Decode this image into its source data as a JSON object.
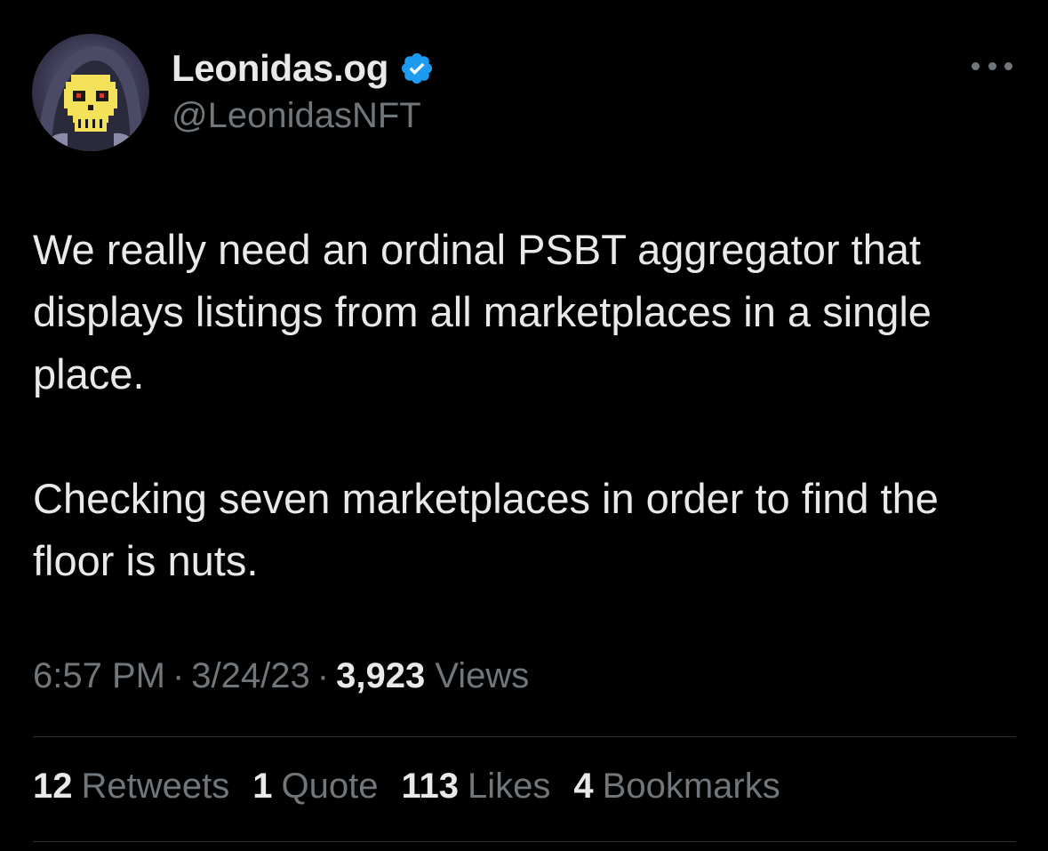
{
  "author": {
    "display_name": "Leonidas.og",
    "handle": "@LeonidasNFT",
    "verified": true,
    "avatar_icon": "pixel-skull-hooded-avatar"
  },
  "tweet": {
    "paragraphs": [
      "We really need an ordinal PSBT aggregator that displays listings from all marketplaces in a single place.",
      "Checking seven marketplaces in order to find the floor is nuts."
    ]
  },
  "meta": {
    "time": "6:57 PM",
    "separator": "·",
    "date": "3/24/23",
    "views_count": "3,923",
    "views_label": "Views"
  },
  "stats": [
    {
      "count": "12",
      "label": "Retweets"
    },
    {
      "count": "1",
      "label": "Quote"
    },
    {
      "count": "113",
      "label": "Likes"
    },
    {
      "count": "4",
      "label": "Bookmarks"
    }
  ],
  "colors": {
    "background": "#000000",
    "primary_text": "#e7e9ea",
    "secondary_text": "#71767b",
    "divider": "#2f3336",
    "verified_badge": "#1d9bf0"
  }
}
